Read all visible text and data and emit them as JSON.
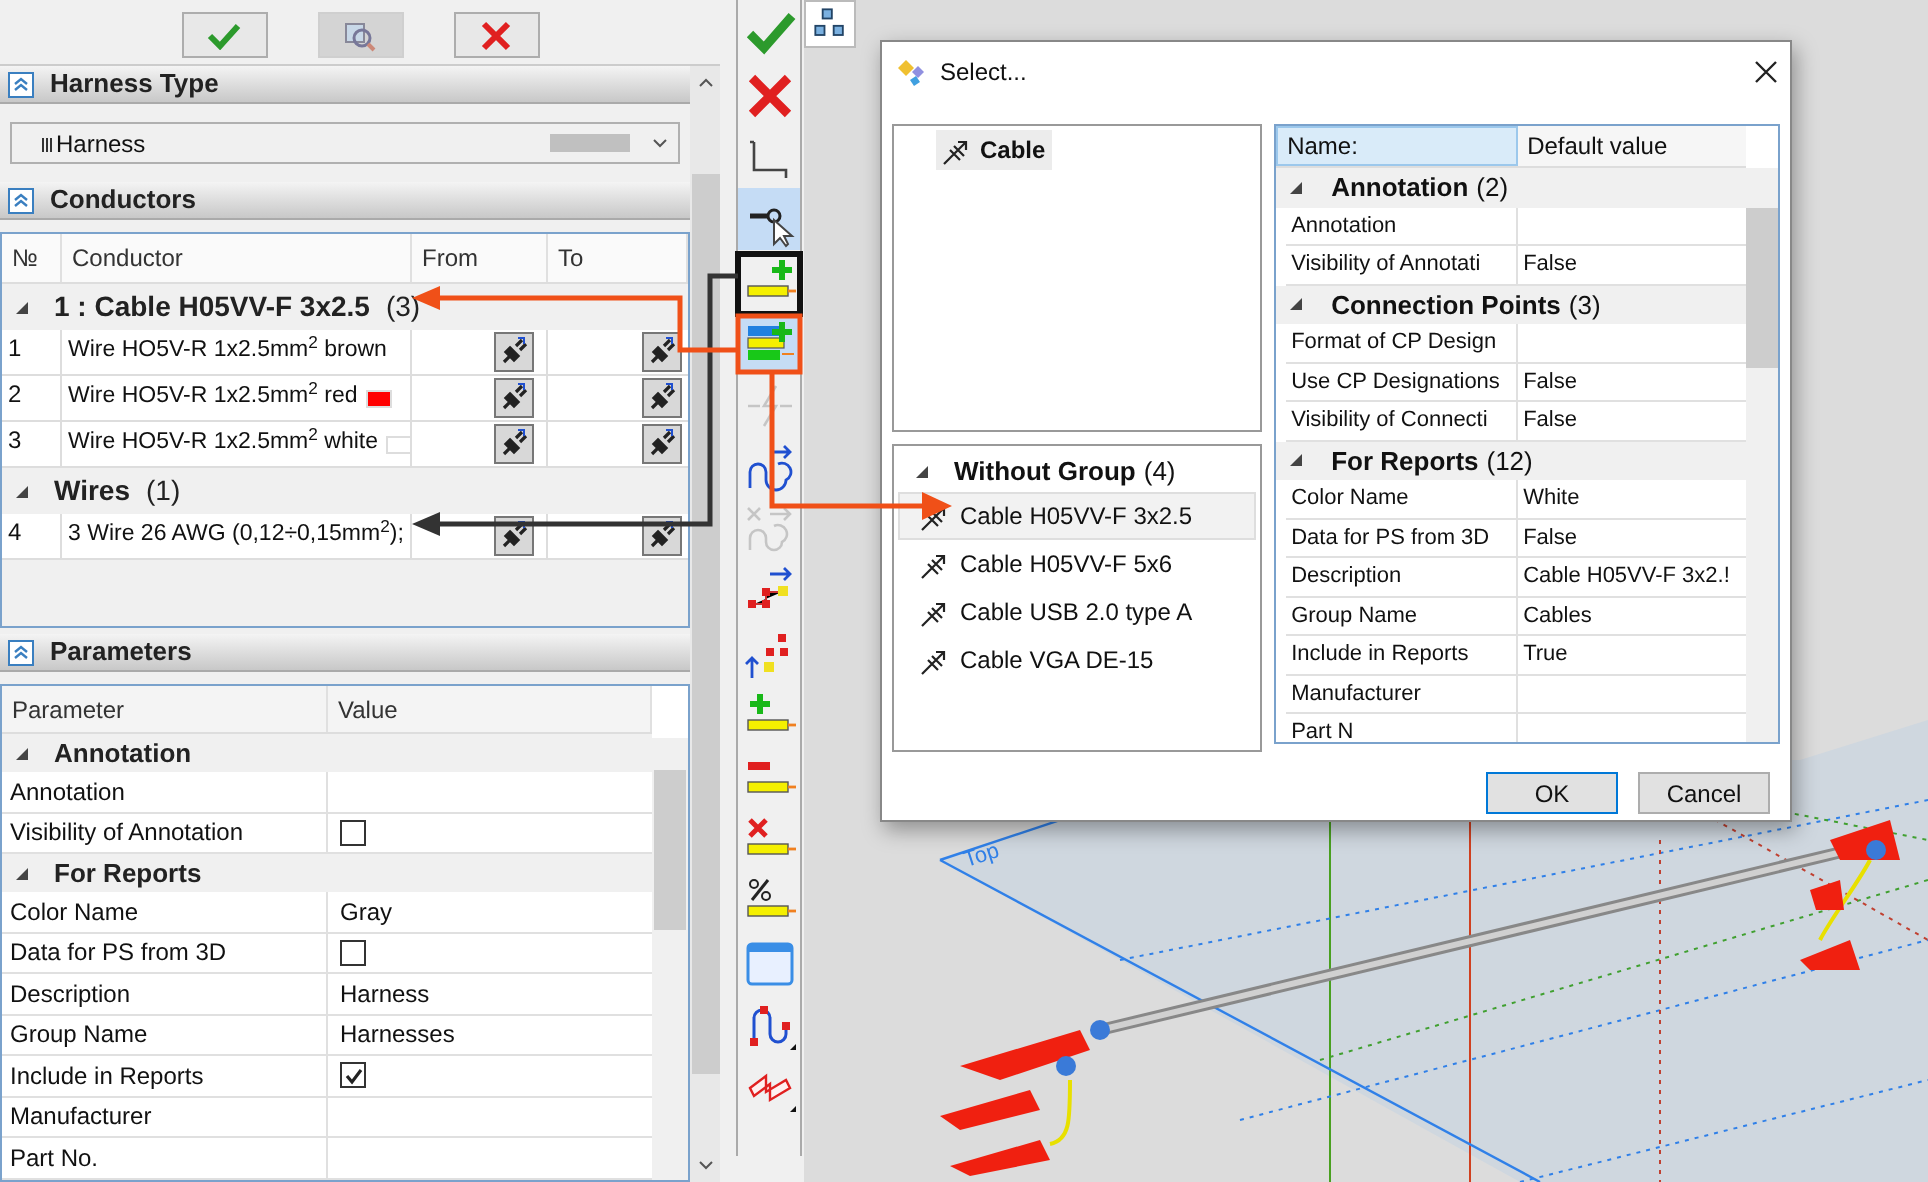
{
  "harness_type": {
    "title": "Harness Type",
    "value": "Harness",
    "expanded": true
  },
  "conductors": {
    "title": "Conductors",
    "expanded": true,
    "columns": [
      "№",
      "Conductor",
      "From",
      "To"
    ],
    "groups": [
      {
        "title": "1 :  Cable  H05VV-F 3x2.5",
        "count": "(3)",
        "expanded": true,
        "rows": [
          {
            "number": "1",
            "name": "Wire HO5V-R 1x2.5mm$^{2}$ brown"
          },
          {
            "number": "2",
            "name": "Wire HO5V-R 1x2.5mm$^{2}$ red",
            "color": "#ff0000"
          },
          {
            "number": "3",
            "name": "Wire HO5V-R 1x2.5mm$^{2}$ white",
            "color": "#ffffff"
          }
        ]
      },
      {
        "title": "Wires",
        "count": "(1)",
        "expanded": true,
        "rows": [
          {
            "number": "4",
            "name": "3 Wire 26 AWG (0,12÷0,15mm$^{2}$);"
          }
        ]
      }
    ]
  },
  "parameters": {
    "title": "Parameters",
    "expanded": true,
    "columns": [
      "Parameter",
      "Value"
    ],
    "groups": [
      {
        "title": "Annotation",
        "expanded": true,
        "rows": [
          {
            "kind": "text",
            "name": "Annotation"
          },
          {
            "kind": "checkbox",
            "name": "Visibility of Annotation",
            "checked": false
          }
        ]
      },
      {
        "title": "For Reports",
        "expanded": true,
        "rows": [
          {
            "kind": "text",
            "name": "Color Name",
            "value": "Gray"
          },
          {
            "kind": "checkbox",
            "name": "Data for PS from 3D",
            "checked": false
          },
          {
            "kind": "text",
            "name": "Description",
            "value": "Harness"
          },
          {
            "kind": "text",
            "name": "Group Name",
            "value": "Harnesses"
          },
          {
            "kind": "checkbox",
            "name": "Include in Reports",
            "checked": true
          },
          {
            "kind": "text",
            "name": "Manufacturer"
          },
          {
            "kind": "text",
            "name": "Part No."
          }
        ]
      }
    ]
  },
  "toolbar": [
    {
      "kind": "accept",
      "selected": false,
      "disabled": false
    },
    {
      "kind": "cancel",
      "selected": false,
      "disabled": false
    },
    {
      "kind": "line",
      "selected": false,
      "disabled": false
    },
    {
      "kind": "pick",
      "selected": true,
      "disabled": false
    },
    {
      "kind": "add-wire",
      "selected": false,
      "disabled": false
    },
    {
      "kind": "add-cable",
      "selected": true,
      "disabled": false
    },
    {
      "kind": "lightning",
      "selected": false,
      "disabled": true
    },
    {
      "kind": "route",
      "selected": false,
      "disabled": false
    },
    {
      "kind": "unroute",
      "selected": false,
      "disabled": true
    },
    {
      "kind": "node-up",
      "selected": false,
      "disabled": false
    },
    {
      "kind": "node-down",
      "selected": false,
      "disabled": false
    },
    {
      "kind": "wire-plus",
      "selected": false,
      "disabled": false
    },
    {
      "kind": "wire-minus",
      "selected": false,
      "disabled": false
    },
    {
      "kind": "wire-delete",
      "selected": false,
      "disabled": false
    },
    {
      "kind": "wire-percent",
      "selected": false,
      "disabled": false
    },
    {
      "kind": "window",
      "selected": false,
      "disabled": false
    },
    {
      "kind": "curve",
      "selected": false,
      "disabled": false
    },
    {
      "kind": "fold",
      "selected": false,
      "disabled": false
    }
  ],
  "viewport": {
    "label": "Top"
  },
  "dialog": {
    "title": "Select...",
    "categories": [
      {
        "label": "Cable",
        "selected": true
      }
    ],
    "group": {
      "title": "Without Group",
      "count": "(4)",
      "expanded": true,
      "items": [
        {
          "label": "Cable  H05VV-F 3x2.5",
          "selected": true
        },
        {
          "label": "Cable  H05VV-F 5x6",
          "selected": false
        },
        {
          "label": "Cable USB 2.0 type A",
          "selected": false
        },
        {
          "label": "Cable VGA DE-15",
          "selected": false
        }
      ]
    },
    "properties": {
      "columns": [
        "Name:",
        "Default value"
      ],
      "groups": [
        {
          "title": "Annotation",
          "count": "(2)",
          "expanded": true,
          "rows": [
            {
              "name": "Annotation"
            },
            {
              "name": "Visibility of Annotati",
              "value": "False"
            }
          ]
        },
        {
          "title": "Connection Points",
          "count": "(3)",
          "expanded": true,
          "rows": [
            {
              "name": "Format of CP Design"
            },
            {
              "name": "Use CP Designations",
              "value": "False"
            },
            {
              "name": "Visibility of Connecti",
              "value": "False"
            }
          ]
        },
        {
          "title": "For Reports",
          "count": "(12)",
          "expanded": true,
          "rows": [
            {
              "name": "Color Name",
              "value": "White"
            },
            {
              "name": "Data for PS from 3D",
              "value": "False"
            },
            {
              "name": "Description",
              "value": "Cable  H05VV-F 3x2.!"
            },
            {
              "name": "Group Name",
              "value": "Cables"
            },
            {
              "name": "Include in Reports",
              "value": "True"
            },
            {
              "name": "Manufacturer"
            },
            {
              "name": "Part N"
            }
          ]
        }
      ]
    },
    "buttons": [
      {
        "label": "OK",
        "selected": true
      },
      {
        "label": "Cancel",
        "selected": false
      }
    ]
  }
}
